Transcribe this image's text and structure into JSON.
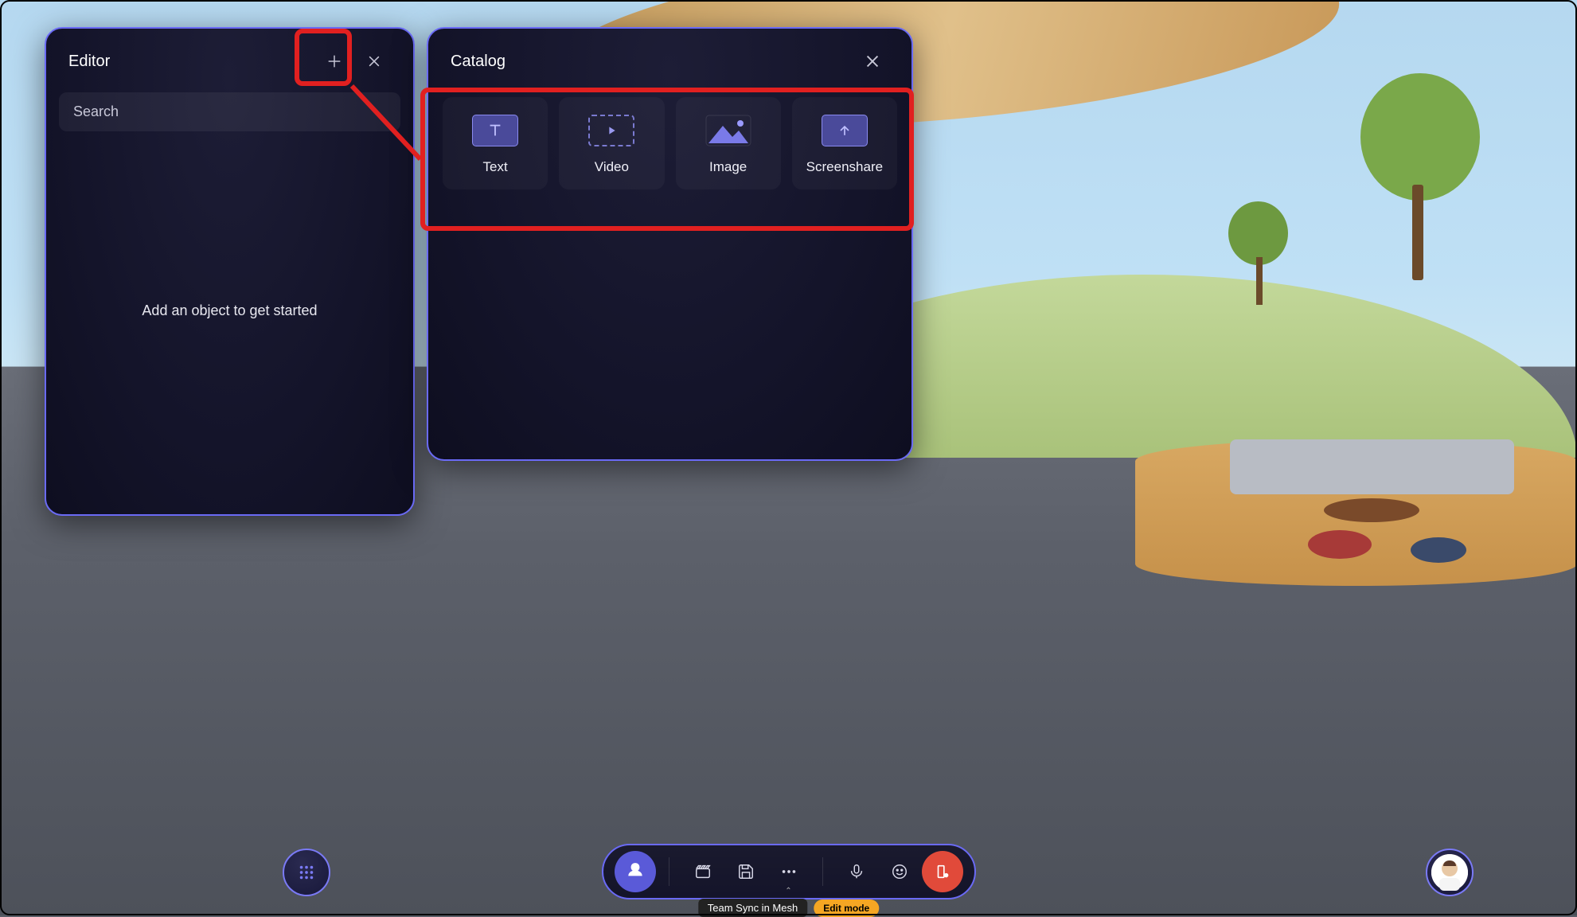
{
  "editor": {
    "title": "Editor",
    "search_placeholder": "Search",
    "empty_message": "Add an object to get started"
  },
  "catalog": {
    "title": "Catalog",
    "items": [
      {
        "label": "Text",
        "icon": "text"
      },
      {
        "label": "Video",
        "icon": "video"
      },
      {
        "label": "Image",
        "icon": "image"
      },
      {
        "label": "Screenshare",
        "icon": "screenshare"
      }
    ]
  },
  "dock": {
    "buttons": [
      {
        "name": "environment",
        "active": true
      },
      {
        "name": "clapperboard"
      },
      {
        "name": "save"
      },
      {
        "name": "more",
        "chevron": true
      },
      {
        "name": "microphone"
      },
      {
        "name": "reactions"
      },
      {
        "name": "leave",
        "red": true
      }
    ]
  },
  "status": {
    "session_name": "Team Sync in Mesh",
    "mode_label": "Edit mode"
  },
  "colors": {
    "panel_border": "#6a6af5",
    "callout": "#e12020",
    "accent": "#5a5ad8",
    "danger": "#e14a3a",
    "warn": "#f5a623"
  }
}
